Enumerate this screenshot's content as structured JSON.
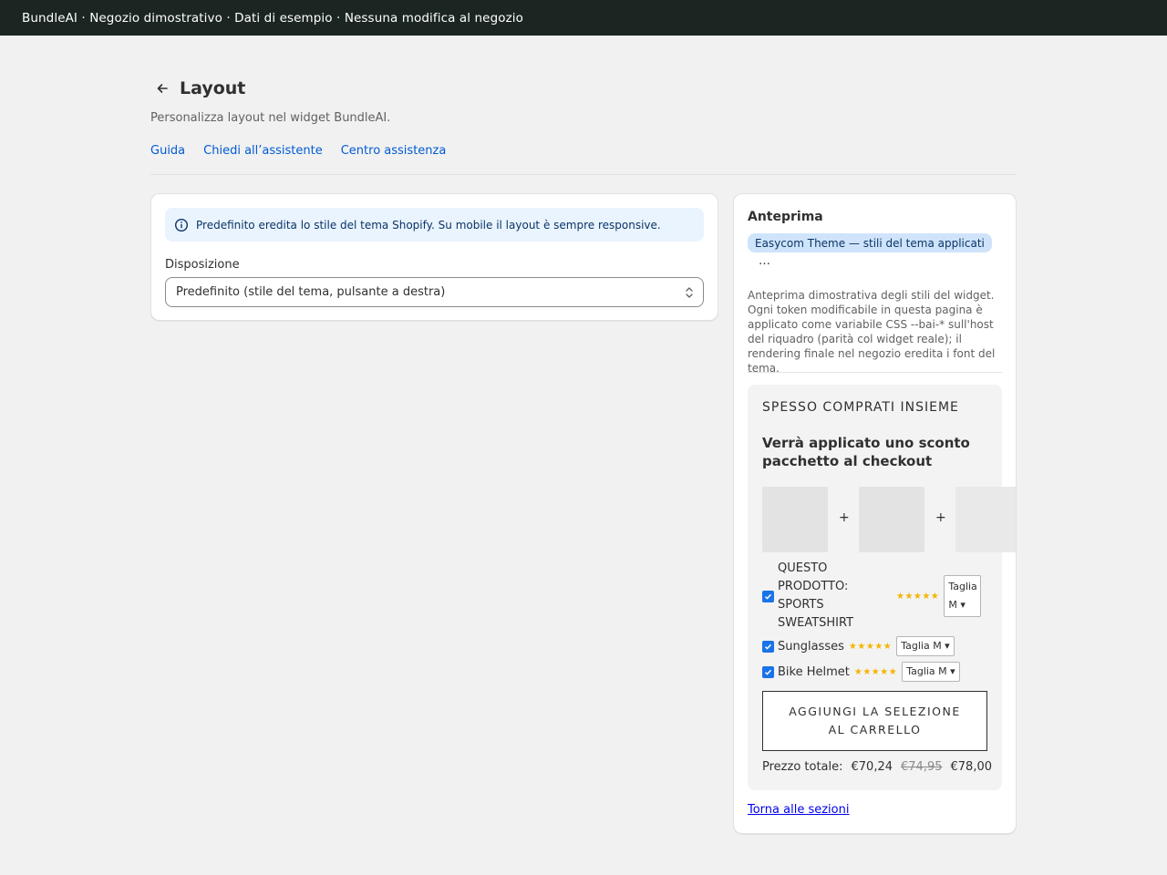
{
  "topbar": {
    "text": "BundleAI · Negozio dimostrativo · Dati di esempio · Nessuna modifica al negozio"
  },
  "header": {
    "title": "Layout",
    "subtitle": "Personalizza layout nel widget BundleAI.",
    "links": [
      "Guida",
      "Chiedi all’assistente",
      "Centro assistenza"
    ]
  },
  "settings": {
    "banner": "Predefinito eredita lo stile del tema Shopify. Su mobile il layout è sempre responsive.",
    "field_label": "Disposizione",
    "field_value": "Predefinito (stile del tema, pulsante a destra)"
  },
  "preview": {
    "title": "Anteprima",
    "theme_badge": "Easycom Theme — stili del tema applicati",
    "ellipsis": "…",
    "description": "Anteprima dimostrativa degli stili del widget. Ogni token modificabile in questa pagina è applicato come variabile CSS --bai-* sull'host del riquadro (parità col widget reale); il rendering finale nel negozio eredita i font del tema.",
    "widget": {
      "kicker": "SPESSO COMPRATI INSIEME",
      "heading": "Verrà applicato uno sconto pacchetto al checkout",
      "plus": "+",
      "items": [
        {
          "label": "QUESTO PRODOTTO: SPORTS SWEATSHIRT",
          "stars": "★★★★★",
          "size": "Taglia M ▾",
          "checked": true
        },
        {
          "label": "Sunglasses",
          "stars": "★★★★★",
          "size": "Taglia M ▾",
          "checked": true
        },
        {
          "label": "Bike Helmet",
          "stars": "★★★★★",
          "size": "Taglia M ▾",
          "checked": true
        }
      ],
      "cta": "AGGIUNGI LA SELEZIONE AL CARRELLO",
      "total_label": "Prezzo totale:",
      "total_price": "€70,24",
      "total_original": "€74,95",
      "total_other": "€78,00"
    },
    "back_link": "Torna alle sezioni"
  }
}
